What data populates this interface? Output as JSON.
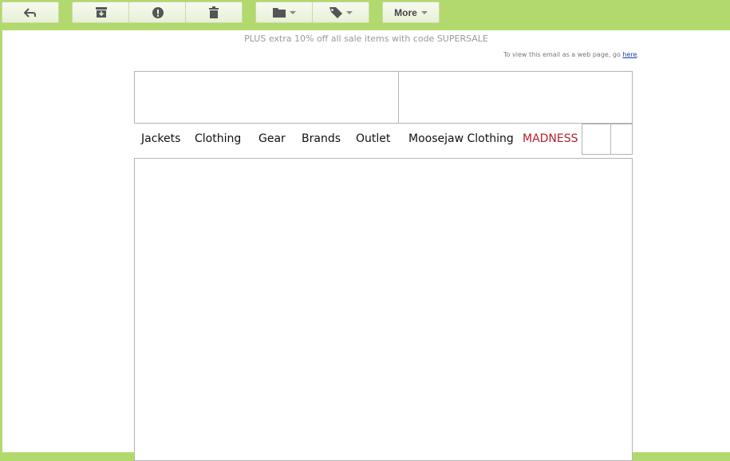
{
  "toolbar": {
    "buttons": [
      {
        "name": "back",
        "icon": "back-arrow-icon"
      },
      {
        "name": "archive",
        "icon": "archive-icon"
      },
      {
        "name": "report-spam",
        "icon": "exclamation-icon"
      },
      {
        "name": "delete",
        "icon": "trash-icon"
      },
      {
        "name": "move-to",
        "icon": "folder-icon"
      },
      {
        "name": "labels",
        "icon": "tag-icon"
      }
    ],
    "more_label": "More",
    "background_color": "#b2d96d"
  },
  "email": {
    "promo_text": "PLUS extra 10% off all sale items with code SUPERSALE",
    "webview_text": "To view this email as a web page, go ",
    "webview_link": "here",
    "webview_suffix": ".",
    "nav": {
      "items": [
        "Jackets",
        "Clothing",
        "Gear",
        "Brands",
        "Outlet",
        "Moosejaw Clothing",
        "MADNESS"
      ],
      "highlight_color": "#b3202b"
    }
  }
}
